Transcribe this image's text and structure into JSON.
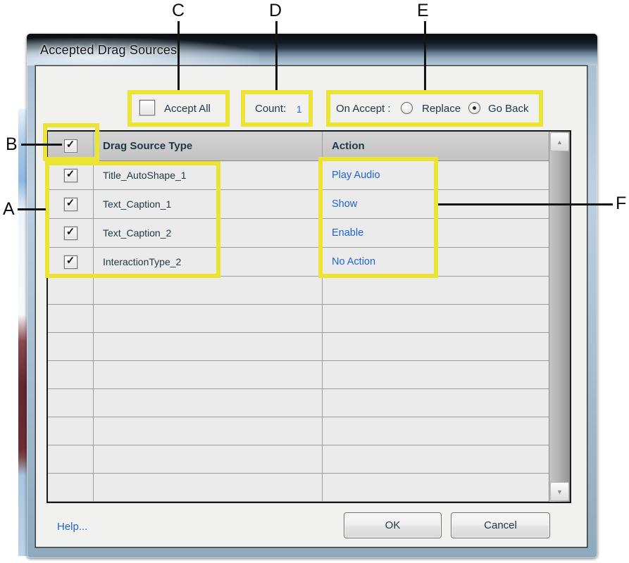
{
  "window": {
    "title": "Accepted Drag Sources"
  },
  "controls": {
    "accept_all_label": "Accept All",
    "accept_all_checked": false,
    "count_label": "Count:",
    "count_value": "1",
    "on_accept_label": "On Accept :",
    "radio_replace_label": "Replace",
    "radio_replace_selected": false,
    "radio_go_back_label": "Go Back",
    "radio_go_back_selected": true
  },
  "table": {
    "header_checkbox_checked": true,
    "columns": {
      "drag_source": "Drag Source Type",
      "action": "Action"
    },
    "rows": [
      {
        "checked": true,
        "name": "Title_AutoShape_1",
        "action": "Play Audio"
      },
      {
        "checked": true,
        "name": "Text_Caption_1",
        "action": "Show"
      },
      {
        "checked": true,
        "name": "Text_Caption_2",
        "action": "Enable"
      },
      {
        "checked": true,
        "name": "InteractionType_2",
        "action": "No Action"
      }
    ],
    "empty_row_count": 8
  },
  "footer": {
    "help_label": "Help...",
    "ok_label": "OK",
    "cancel_label": "Cancel"
  },
  "annotations": {
    "a": "A",
    "b": "B",
    "c": "C",
    "d": "D",
    "e": "E",
    "f": "F"
  },
  "icons": {
    "checkmark": "✓",
    "scroll_up": "▲",
    "scroll_down": "▼"
  },
  "colors": {
    "annotation_yellow": "#ece433",
    "link_blue": "#1e63d6",
    "label_dark": "#1e3742",
    "row_bg": "#ebebeb",
    "header_bg": "#c9c9c9"
  }
}
